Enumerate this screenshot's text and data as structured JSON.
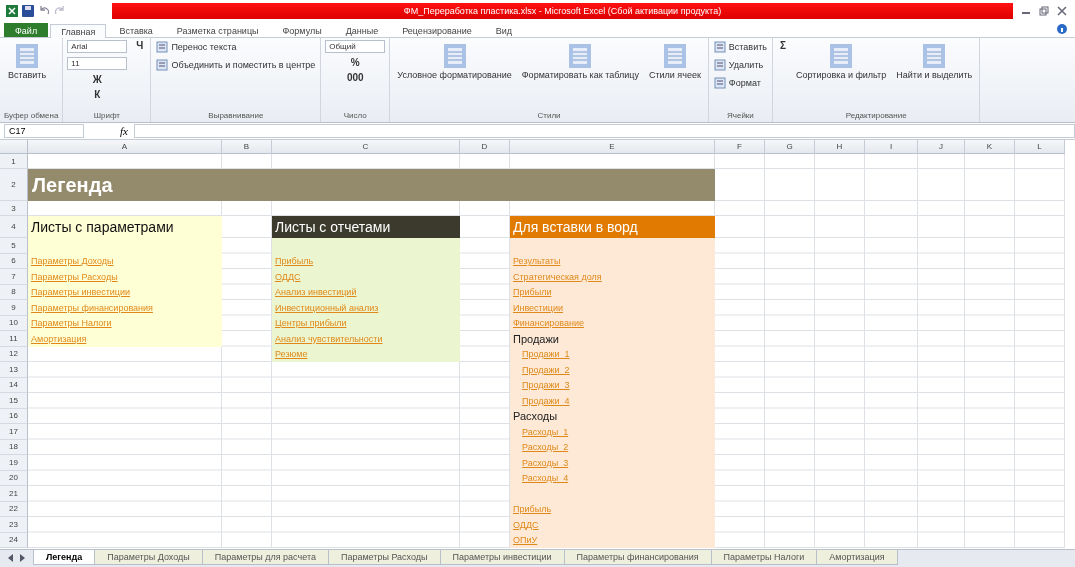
{
  "window": {
    "title": "ФМ_Переработка пластика.xlsx - Microsoft Excel (Сбой активации продукта)"
  },
  "ribbon": {
    "tabs": [
      {
        "label": "Файл",
        "kind": "file",
        "selected": false
      },
      {
        "label": "Главная",
        "kind": "tab",
        "selected": true
      },
      {
        "label": "Вставка",
        "kind": "tab",
        "selected": false
      },
      {
        "label": "Разметка страницы",
        "kind": "tab",
        "selected": false
      },
      {
        "label": "Формулы",
        "kind": "tab",
        "selected": false
      },
      {
        "label": "Данные",
        "kind": "tab",
        "selected": false
      },
      {
        "label": "Рецензирование",
        "kind": "tab",
        "selected": false
      },
      {
        "label": "Вид",
        "kind": "tab",
        "selected": false
      }
    ],
    "groups": [
      {
        "label": "Буфер обмена",
        "controls": [
          {
            "kind": "large",
            "label": "Вставить"
          }
        ]
      },
      {
        "label": "Шрифт",
        "controls": [
          {
            "kind": "field",
            "value": "Arial"
          },
          {
            "kind": "field",
            "value": "11"
          },
          {
            "kind": "glyph",
            "label": "Ж"
          },
          {
            "kind": "glyph",
            "label": "К"
          },
          {
            "kind": "glyph",
            "label": "Ч"
          }
        ]
      },
      {
        "label": "Выравнивание",
        "controls": [
          {
            "kind": "small",
            "label": "Перенос текста"
          },
          {
            "kind": "small",
            "label": "Объединить и поместить в центре"
          }
        ]
      },
      {
        "label": "Число",
        "controls": [
          {
            "kind": "field",
            "value": "Общий"
          },
          {
            "kind": "glyph",
            "label": "%"
          },
          {
            "kind": "glyph",
            "label": "000"
          }
        ]
      },
      {
        "label": "Стили",
        "controls": [
          {
            "kind": "large",
            "label": "Условное форматирование"
          },
          {
            "kind": "large",
            "label": "Форматировать как таблицу"
          },
          {
            "kind": "large",
            "label": "Стили ячеек"
          }
        ]
      },
      {
        "label": "Ячейки",
        "controls": [
          {
            "kind": "small",
            "label": "Вставить"
          },
          {
            "kind": "small",
            "label": "Удалить"
          },
          {
            "kind": "small",
            "label": "Формат"
          }
        ]
      },
      {
        "label": "Редактирование",
        "controls": [
          {
            "kind": "glyph",
            "label": "Σ"
          },
          {
            "kind": "large",
            "label": "Сортировка и фильтр"
          },
          {
            "kind": "large",
            "label": "Найти и выделить"
          }
        ]
      }
    ]
  },
  "formula_bar": {
    "name_box": "C17",
    "function_label": "fx"
  },
  "sheet": {
    "columns": [
      "A",
      "B",
      "C",
      "D",
      "E",
      "F",
      "G",
      "H",
      "I",
      "J",
      "K",
      "L"
    ],
    "rows": [
      "1",
      "2",
      "3",
      "4",
      "5",
      "6",
      "7",
      "8",
      "9",
      "10",
      "11",
      "12",
      "13",
      "14",
      "15",
      "16",
      "17",
      "18",
      "19",
      "20",
      "21",
      "22",
      "23",
      "24"
    ],
    "title": "Легенда",
    "lists": [
      {
        "header": "Листы с параметрами",
        "kind": "light",
        "sections": [
          [
            {
              "text": "Параметры Доходы",
              "kind": "link"
            },
            {
              "text": "Параметры Расходы",
              "kind": "link"
            },
            {
              "text": "Параметры инвестиции",
              "kind": "link"
            },
            {
              "text": "Параметры финансирования",
              "kind": "link"
            },
            {
              "text": "Параметры Налоги",
              "kind": "link"
            },
            {
              "text": "Амортизация",
              "kind": "link"
            }
          ]
        ]
      },
      {
        "header": "Листы с отчетами",
        "kind": "dark",
        "sections": [
          [
            {
              "text": "Прибыль",
              "kind": "link"
            },
            {
              "text": "ОДДС",
              "kind": "link"
            },
            {
              "text": "Анализ инвестиций",
              "kind": "link"
            },
            {
              "text": "Инвестиционный анализ",
              "kind": "link"
            },
            {
              "text": "Центры прибыли",
              "kind": "link"
            },
            {
              "text": "Анализ чувствительности",
              "kind": "link"
            },
            {
              "text": "Резюме",
              "kind": "link"
            }
          ]
        ]
      },
      {
        "header": "Для вставки в ворд",
        "kind": "orange",
        "sections": [
          [
            {
              "text": "Результаты",
              "kind": "link"
            },
            {
              "text": "Стратегическая доля",
              "kind": "link"
            },
            {
              "text": "Прибыли",
              "kind": "link"
            },
            {
              "text": "Инвестиции",
              "kind": "link"
            },
            {
              "text": "Финансирование",
              "kind": "link"
            },
            {
              "text": "Продажи",
              "kind": "label",
              "children": [
                {
                  "text": "Продажи_1",
                  "kind": "link"
                },
                {
                  "text": "Продажи_2",
                  "kind": "link"
                },
                {
                  "text": "Продажи_3",
                  "kind": "link"
                },
                {
                  "text": "Продажи_4",
                  "kind": "link"
                }
              ]
            },
            {
              "text": "Расходы",
              "kind": "label",
              "children": [
                {
                  "text": "Расходы_1",
                  "kind": "link"
                },
                {
                  "text": "Расходы_2",
                  "kind": "link"
                },
                {
                  "text": "Расходы_3",
                  "kind": "link"
                },
                {
                  "text": "Расходы_4",
                  "kind": "link"
                }
              ]
            }
          ],
          [
            {
              "text": "Прибыль",
              "kind": "link"
            },
            {
              "text": "ОДДС",
              "kind": "link"
            },
            {
              "text": "ОПиУ",
              "kind": "link"
            }
          ]
        ]
      }
    ]
  },
  "sheet_tabs": [
    {
      "label": "Легенда",
      "selected": true
    },
    {
      "label": "Параметры Доходы",
      "selected": false
    },
    {
      "label": "Параметры для расчета",
      "selected": false
    },
    {
      "label": "Параметры Расходы",
      "selected": false
    },
    {
      "label": "Параметры инвестиции",
      "selected": false
    },
    {
      "label": "Параметры финансирования",
      "selected": false
    },
    {
      "label": "Параметры Налоги",
      "selected": false
    },
    {
      "label": "Амортизация",
      "selected": false
    }
  ]
}
